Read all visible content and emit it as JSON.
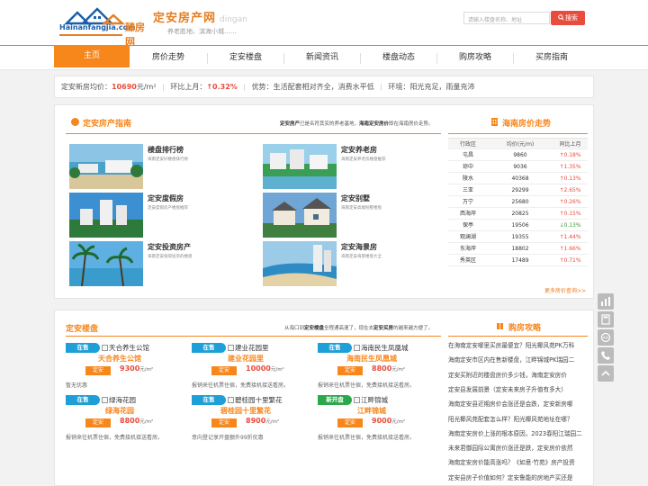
{
  "header": {
    "logo_domain": "Hainanfangjia.com",
    "logo_brand": "臻房网",
    "site_title": "定安房产网",
    "site_title_en": "dingan",
    "slogan": "养老胜地、滨海小城……",
    "search_placeholder": "请输入楼盘名称、地址",
    "search_button": "搜索"
  },
  "nav": {
    "items": [
      "主页",
      "房价走势",
      "定安楼盘",
      "新闻资讯",
      "楼盘动态",
      "购房攻略",
      "买房指南"
    ],
    "active_index": 0
  },
  "ticker": {
    "avg_label": "定安新房均价：",
    "avg_value": "10690",
    "avg_unit": "元/m²",
    "mom_label": "环比上月：",
    "mom_value": "↑0.32%",
    "advantage": "优势：生活配套相对齐全，消费水平低",
    "environment": "环境：阳光充足，雨量充沛"
  },
  "guide": {
    "title": "定安房产指南",
    "desc_pre": "定安房产",
    "desc_mid": "已是名符其实的养老基地，",
    "desc_bold2": "海南定安房价",
    "desc_post": "即在海南房价走势。",
    "items": [
      {
        "title": "楼盘排行榜",
        "sub": "海南定安好楼盘排行榜"
      },
      {
        "title": "定安养老房",
        "sub": "海南定安养老房楼盘推荐"
      },
      {
        "title": "定安度假房",
        "sub": "定安度假房产楼盘推荐"
      },
      {
        "title": "定安别墅",
        "sub": "海南定安高端别墅楼盘"
      },
      {
        "title": "定安投资房产",
        "sub": "海南定安值得投资的楼盘"
      },
      {
        "title": "定安海景房",
        "sub": "海南定安海景楼盘大全"
      }
    ]
  },
  "price_trend": {
    "title": "海南房价走势",
    "headers": [
      "行政区",
      "均价(元/m)",
      "同比上月"
    ],
    "rows": [
      {
        "district": "屯昌",
        "price": "9860",
        "change": "↑0.18%",
        "dir": "up"
      },
      {
        "district": "琼中",
        "price": "9036",
        "change": "↑1.35%",
        "dir": "up"
      },
      {
        "district": "陵水",
        "price": "40368",
        "change": "↑0.13%",
        "dir": "up"
      },
      {
        "district": "三亚",
        "price": "29299",
        "change": "↑2.65%",
        "dir": "up"
      },
      {
        "district": "万宁",
        "price": "25680",
        "change": "↑0.26%",
        "dir": "up"
      },
      {
        "district": "西海岸",
        "price": "20825",
        "change": "↑0.15%",
        "dir": "up"
      },
      {
        "district": "保亭",
        "price": "19506",
        "change": "↓0.13%",
        "dir": "down"
      },
      {
        "district": "观澜湖",
        "price": "19355",
        "change": "↑1.44%",
        "dir": "up"
      },
      {
        "district": "东海岸",
        "price": "18802",
        "change": "↑1.66%",
        "dir": "up"
      },
      {
        "district": "秀英区",
        "price": "17489",
        "change": "↑0.71%",
        "dir": "up"
      }
    ],
    "more": "更多房价查询>>"
  },
  "listings": {
    "title": "定安楼盘",
    "desc_pre": "从海口到",
    "desc_b1": "定安楼盘",
    "desc_mid": "全程通高速了，现在去",
    "desc_b2": "定安买房",
    "desc_post": "的越来越方便了。",
    "price_tag": "定安",
    "items": [
      {
        "status": "在售",
        "alt": "天合养生公馆",
        "name": "天合养生公馆",
        "price": "9300",
        "unit": "元/m²",
        "note": "暂无优惠",
        "tag": "blue"
      },
      {
        "status": "在售",
        "alt": "建业花园里",
        "name": "建业花园里",
        "price": "10000",
        "unit": "元/m²",
        "note": "报销来往机票住宿，免费接机接送看房。",
        "tag": "blue"
      },
      {
        "status": "在售",
        "alt": "海南民生凤凰城",
        "name": "海南民生凤凰城",
        "price": "8800",
        "unit": "元/m²",
        "note": "报销来往机票住宿，免费接机接送看房。",
        "tag": "blue"
      },
      {
        "status": "在售",
        "alt": "绿海花园",
        "name": "绿海花园",
        "price": "8800",
        "unit": "元/m²",
        "note": "报销来往机票住宿，免费接机接送看房。",
        "tag": "blue"
      },
      {
        "status": "在售",
        "alt": "碧桂园十里繁花",
        "name": "碧桂园十里繁花",
        "price": "8900",
        "unit": "元/m²",
        "note": "意向登记享开盘额外99折优惠",
        "tag": "blue"
      },
      {
        "status": "新开盘",
        "alt": "江畔锦城",
        "name": "江畔锦城",
        "price": "9000",
        "unit": "元/m²",
        "note": "报销来往机票住宿，免费接机接送看房。",
        "tag": "green"
      }
    ]
  },
  "strategy": {
    "title": "购房攻略",
    "items": [
      "在海南定安哪里买房最便宜？阳光椰风苑PK万科",
      "海南定安市区内在售新楼盘，江畔锦城PK瑞园二",
      "定安买附近的楼盘房价多少钱，海南定安房价",
      "定安县发展前景（定安未来房子升值有多大）",
      "海南定安县近期房价会涨还是会跌，定安新房哪",
      "阳光椰风苑配套怎么样？阳光椰风苑地址在哪？",
      "海南定安房价上涨的根本原因，2023春阳江瑞园二",
      "未来君御园际公寓房价涨还是跌，定安房价依然",
      "海南定安房价能高涨吗？《如意·竹苑》房产投资",
      "定安县房子价值如何？定安鲁能的房地产买还是"
    ]
  },
  "colors": {
    "accent": "#f7861b",
    "red": "#e84c3d",
    "blue_tag": "#1e9fd8",
    "green_tag": "#2aa84a"
  }
}
